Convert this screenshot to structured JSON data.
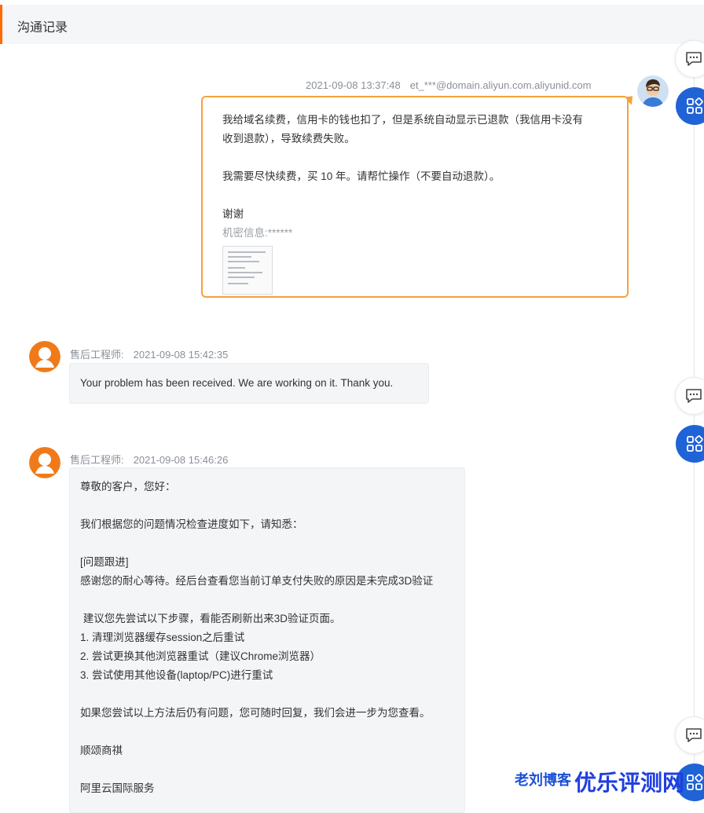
{
  "header": {
    "title": "沟通记录"
  },
  "messages": {
    "customer": {
      "time": "2021-09-08 13:37:48",
      "account": "et_***@domain.aliyun.com.aliyunid.com",
      "lines": [
        "我给域名续费，信用卡的钱也扣了，但是系统自动显示已退款（我信用卡没有",
        "收到退款），导致续费失败。",
        "",
        "我需要尽快续费，买 10 年。请帮忙操作（不要自动退款）。",
        "",
        "谢谢"
      ],
      "secret_label": "机密信息:******"
    },
    "reply1": {
      "role": "售后工程师:",
      "time": "2021-09-08 15:42:35",
      "text": "Your problem has been received. We are working on it. Thank you."
    },
    "reply2": {
      "role": "售后工程师:",
      "time": "2021-09-08 15:46:26",
      "lines": [
        "尊敬的客户，您好：",
        "",
        "我们根据您的问题情况检查进度如下，请知悉：",
        "",
        "[问题跟进]",
        "感谢您的耐心等待。经后台查看您当前订单支付失败的原因是未完成3D验证",
        "",
        " 建议您先尝试以下步骤，看能否刷新出来3D验证页面。",
        "1. 清理浏览器缓存session之后重试",
        "2. 尝试更换其他浏览器重试（建议Chrome浏览器）",
        "3. 尝试使用其他设备(laptop/PC)进行重试",
        "",
        "如果您尝试以上方法后仍有问题，您可随时回复，我们会进一步为您查看。",
        "",
        "顺颂商祺",
        "",
        "阿里云国际服务"
      ]
    }
  },
  "watermark": {
    "small": "老刘博客",
    "large": "优乐评测网"
  },
  "icons": {
    "chat": "chat-icon",
    "apps": "apps-grid-icon",
    "avatar_agent": "engineer-avatar-icon",
    "avatar_customer": "customer-avatar-icon"
  },
  "colors": {
    "accent": "#ff6a00",
    "bubble_border": "#f5a13d",
    "side_button": "#1f63d6",
    "watermark": "#1f3fe0"
  }
}
